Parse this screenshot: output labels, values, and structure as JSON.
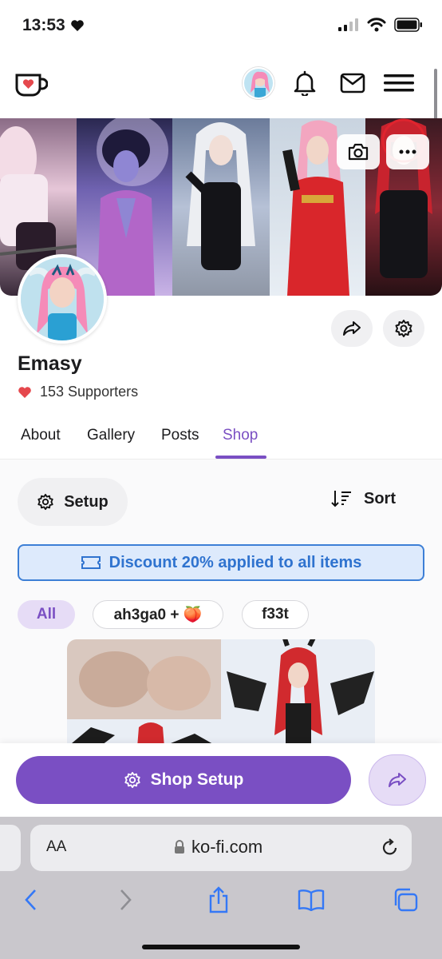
{
  "status_bar": {
    "time": "13:53",
    "icons": [
      "heart-icon",
      "signal-icon",
      "wifi-icon",
      "battery-icon"
    ]
  },
  "header": {
    "icons": [
      "kofi-cup-logo",
      "avatar",
      "bell-icon",
      "mail-icon",
      "menu-icon"
    ]
  },
  "banner": {
    "buttons": [
      "camera-icon",
      "more-icon"
    ]
  },
  "profile": {
    "name": "Emasy",
    "supporters": "153 Supporters"
  },
  "tabs": [
    {
      "label": "About"
    },
    {
      "label": "Gallery"
    },
    {
      "label": "Posts"
    },
    {
      "label": "Shop",
      "active": true
    }
  ],
  "shop": {
    "setup_label": "Setup",
    "sort_label": "Sort",
    "discount_text": "Discount 20% applied to all items",
    "filters": [
      {
        "label": "All",
        "active": true
      },
      {
        "label": "ah3ga0 + 🍑",
        "active": false
      },
      {
        "label": "f33t",
        "active": false
      }
    ]
  },
  "bottom_bar": {
    "shop_setup_label": "Shop Setup"
  },
  "browser": {
    "aa_label": "AA",
    "url": "ko-fi.com"
  },
  "colors": {
    "accent": "#7a4fc3",
    "accent_light": "#e6dcf6",
    "discount_blue": "#2f73cf",
    "discount_bg": "#ddeafc",
    "heart": "#e5484d",
    "ios_blue": "#3478f6"
  }
}
